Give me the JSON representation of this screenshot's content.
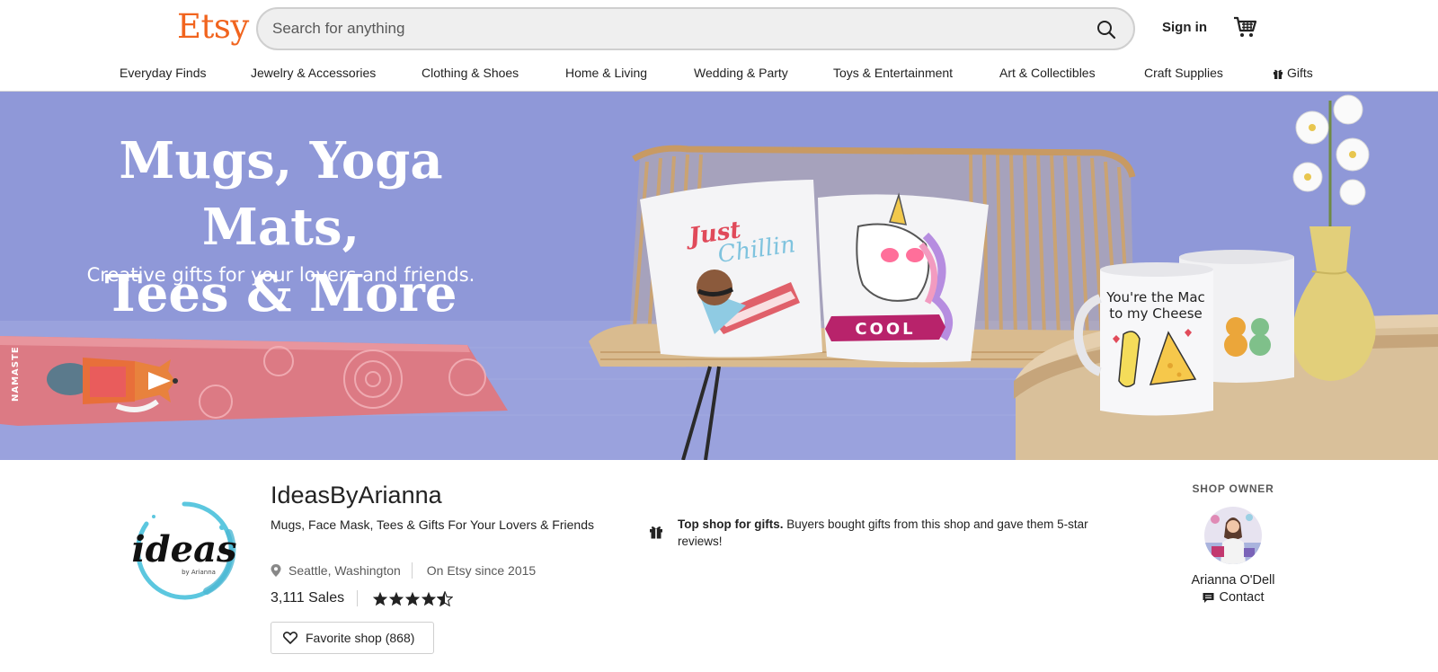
{
  "header": {
    "logo": "Etsy",
    "search_placeholder": "Search for anything",
    "signin_label": "Sign in"
  },
  "nav": {
    "items": [
      "Everyday Finds",
      "Jewelry & Accessories",
      "Clothing & Shoes",
      "Home & Living",
      "Wedding & Party",
      "Toys & Entertainment",
      "Art & Collectibles",
      "Craft Supplies",
      "Gifts"
    ]
  },
  "banner": {
    "title_line1": "Mugs, Yoga Mats,",
    "title_line2": "Tees & More",
    "subtitle": "Creative gifts for your lovers and friends.",
    "mat_text": "NAMASTE",
    "pillow1_text1": "Just",
    "pillow1_text2": "Chillin",
    "pillow2_text": "COOL",
    "mug_text1": "You're the Mac",
    "mug_text2": "to my Cheese"
  },
  "shop": {
    "logo_text": "ideas",
    "logo_subtext": "by Arianna",
    "name": "IdeasByArianna",
    "tagline": "Mugs, Face Mask, Tees & Gifts For Your Lovers & Friends",
    "location": "Seattle, Washington",
    "since": "On Etsy since 2015",
    "sales": "3,111 Sales",
    "rating": 4.5,
    "favorite_label": "Favorite shop (868)"
  },
  "gift_note": {
    "bold": "Top shop for gifts.",
    "text": " Buyers bought gifts from this shop and gave them 5-star reviews!"
  },
  "owner": {
    "label": "SHOP OWNER",
    "name": "Arianna O'Dell",
    "contact_label": "Contact"
  },
  "colors": {
    "brand": "#f1641e",
    "banner_bg": "#8c95d6"
  }
}
